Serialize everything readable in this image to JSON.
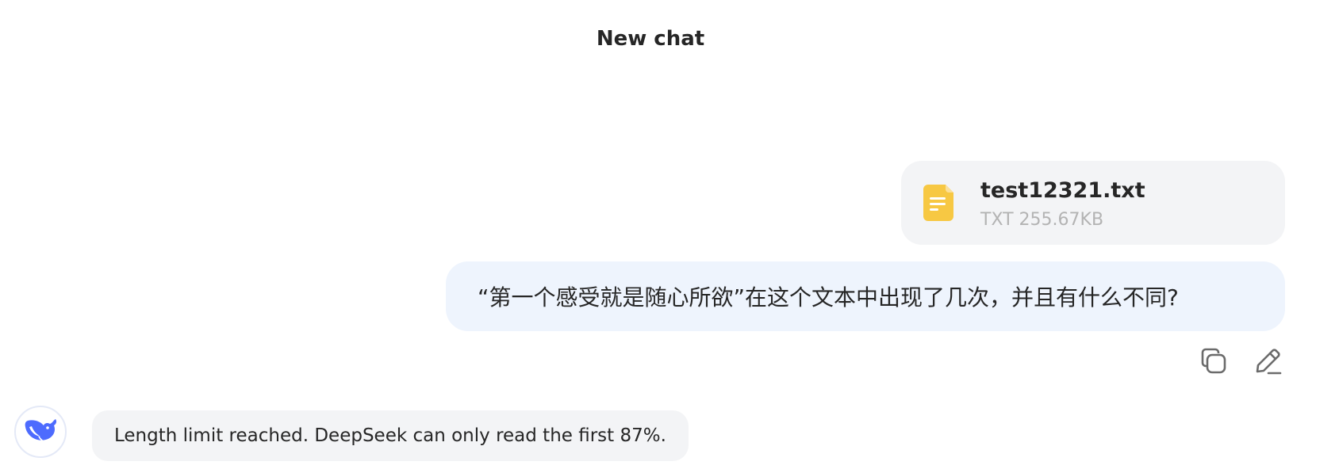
{
  "header": {
    "title": "New chat"
  },
  "attachment": {
    "file_name": "test12321.txt",
    "file_meta": "TXT 255.67KB",
    "icon": "text-file-icon",
    "icon_color": "#f7c843"
  },
  "user_message": {
    "text": "“第一个感受就是随心所欲”在这个文本中出现了几次，并且有什么不同?"
  },
  "message_actions": {
    "copy_icon": "copy-icon",
    "edit_icon": "edit-icon"
  },
  "assistant": {
    "avatar_icon": "deepseek-whale-icon",
    "brand_color": "#4d6bfe",
    "notice": "Length limit reached. DeepSeek can only read the first 87%."
  }
}
